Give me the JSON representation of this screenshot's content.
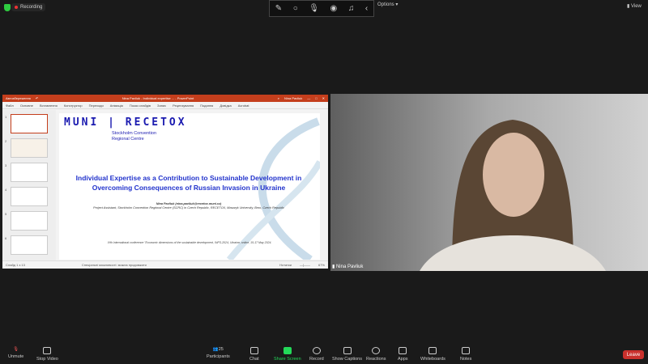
{
  "top": {
    "recording": "Recording",
    "options": "Options",
    "view": "View"
  },
  "ppt": {
    "save_label": "Автозбереження",
    "window_title": "Nina Pavliuk - Individual expertise ... - PowerPoint",
    "user": "Nina Pavliuk",
    "ribbon": [
      "Файл",
      "Основне",
      "Вставлення",
      "Конструктор",
      "Переходи",
      "Анімація",
      "Показ слайдів",
      "Запис",
      "Рецензування",
      "Подання",
      "Довідка",
      "Acrobat"
    ],
    "status_left": "Слайд 1 з 13",
    "status_mid": "Спеціальні можливості: можна продовжити",
    "notes": "Нотатки",
    "zoom": "67%"
  },
  "slide": {
    "logo": "MUNI | RECETOX",
    "subtitle1": "Stockholm Convention",
    "subtitle2": "Regional Centre",
    "title": "Individual Expertise as a Contribution to Sustainable Development in Overcoming Consequences of Russian Invasion in Ukraine",
    "author": "Nina Pavliuk (nina.pavliuk@recetox.muni.cz)",
    "affil": "Project Assistant, Stockholm Convention Regional Centre (SCRC) in Czech Republic, RECETOX, Masaryk University, Brno, Czech Republic",
    "cite": "IVth International conference \"Economic dimensions of the sustainable development, INFS-2024, Ukraine, online, 15-17 May 2024."
  },
  "thumb_numbers": [
    "1",
    "2",
    "3",
    "4",
    "5",
    "6"
  ],
  "video": {
    "participant": "Nina Pavliuk"
  },
  "toolbar": {
    "unmute": "Unmute",
    "stop_video": "Stop Video",
    "participants": "Participants",
    "participant_count": "25",
    "chat": "Chat",
    "share_screen": "Share Screen",
    "record": "Record",
    "captions": "Show Captions",
    "reactions": "Reactions",
    "apps": "Apps",
    "whiteboards": "Whiteboards",
    "notes": "Notes",
    "leave": "Leave"
  },
  "colors": {
    "ppt": "#c43e1c",
    "share_green": "#23d959",
    "leave": "#c9302c",
    "slide_blue": "#2233cc"
  }
}
